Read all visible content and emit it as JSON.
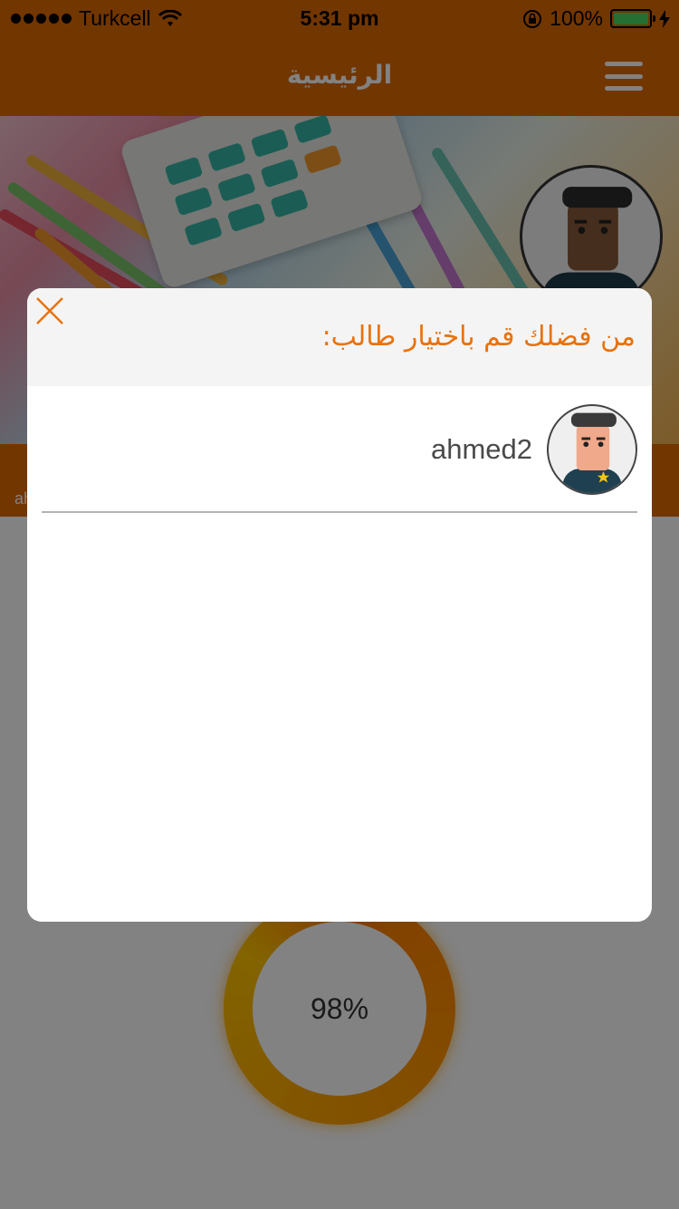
{
  "status_bar": {
    "carrier": "Turkcell",
    "time": "5:31 pm",
    "battery_percent": "100%",
    "signal_bars": 5
  },
  "nav": {
    "title": "الرئيسية",
    "menu_icon": "hamburger-menu-icon"
  },
  "background": {
    "strip_text": "ah",
    "progress_label": "98%",
    "progress_value": 0.98
  },
  "modal": {
    "title": "من فضلك قم باختيار طالب:",
    "close_icon": "close-icon",
    "students": [
      {
        "name": "ahmed2",
        "avatar_icon": "student-avatar-icon"
      }
    ]
  },
  "colors": {
    "accent": "#e06a00",
    "title_orange": "#e8720c",
    "ring_start": "#ff7a00",
    "ring_end": "#ffc400"
  }
}
